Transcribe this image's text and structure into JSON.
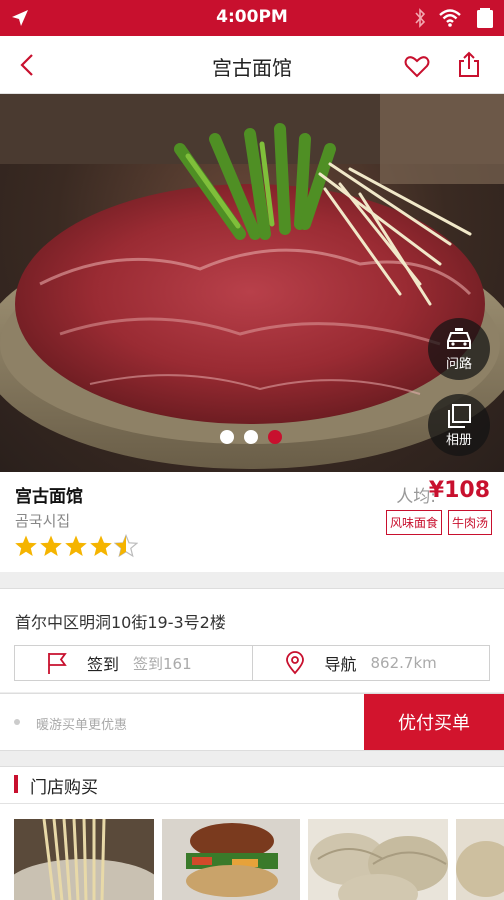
{
  "status_bar": {
    "time": "4:00PM"
  },
  "header": {
    "title": "宫古面馆"
  },
  "hero": {
    "dots": [
      {
        "active": false
      },
      {
        "active": false
      },
      {
        "active": true
      }
    ],
    "route_label": "问路",
    "album_label": "相册"
  },
  "info": {
    "name": "宫古面馆",
    "subtitle": "곰국시집",
    "rating": 4.5,
    "price_label": "人均:",
    "price": "¥108",
    "tags": [
      "风味面食",
      "牛肉汤"
    ]
  },
  "address": {
    "text": "首尔中区明洞10街19-3号2楼",
    "checkin_label": "签到",
    "checkin_value": "签到161",
    "nav_label": "导航",
    "nav_value": "862.7km"
  },
  "promo": {
    "text": "暖游买单更优惠",
    "button_label": "优付买单"
  },
  "store": {
    "heading": "门店购买"
  },
  "colors": {
    "brand": "#c8102e",
    "star": "#f5b400"
  }
}
